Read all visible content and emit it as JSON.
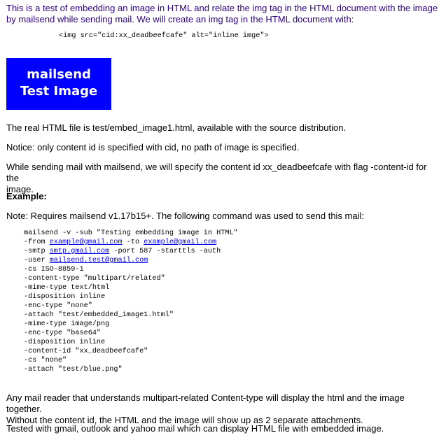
{
  "intro": {
    "line1": "This is a test of embedding an image in HTML and relate the img tag in the HTML document with the image",
    "line2": "by mailsend while sending mail. We will create an img tag in the HTML document with:"
  },
  "img_tag_example": "<img src=\"cid:xx_deadbeefcafe\" alt=\"inline imge\">",
  "image": {
    "line1": "mailsend",
    "line2": "Test Image",
    "color": "#0000ff"
  },
  "para_real_file": "The real HTML file is test/embed_image1.html, available with the source distribution.",
  "para_notice": "Notice: only content id is specified with cid, no path of image is specified.",
  "para_while": {
    "line1": "While sending mail with mailsend, we will specify the content id xx_deadbeefcafe with flag -content-id for the",
    "line2": "image."
  },
  "example_heading": "Example:",
  "para_note": "Note: Requires mailsend v1.17b15+. The following command was used to send this mail:",
  "code": {
    "line1": "mailsend -v -sub \"Testing embedding image in HTML\"",
    "from_prefix": "-from ",
    "from_email": "example@gmail.com",
    "to_prefix": " -to ",
    "to_email": "example@gmail.com",
    "smtp_prefix": "-smtp ",
    "smtp_host": "smtp.gmail.com",
    "smtp_suffix": " -port 587 -starttls -auth",
    "user_prefix": "-user ",
    "user_email": "mailsend.test@gmail.com",
    "rest": [
      "-cs ISO-8859-1",
      "-content-type \"multipart/related\"",
      "-mime-type text/html",
      "-disposition inline",
      "-enc-type \"none\"",
      "-attach \"test/embedded_image1.html\"",
      "-mime-type image/png",
      "-enc-type \"base64\"",
      "-disposition inline",
      "-content-id \"xx_deadbeefcafe\"",
      "-cs \"none\"",
      "-attach \"test/blue.png\""
    ]
  },
  "para_any": {
    "line1": "Any mail reader that understands multipart-related Content-type will display the html and the image together.",
    "line2": "Without the content id, the HTML and the image will show up as 2 separate attachments."
  },
  "para_tested": "Tested with gmail, outlook and yahoo mail which can display HTML file with embedded image."
}
